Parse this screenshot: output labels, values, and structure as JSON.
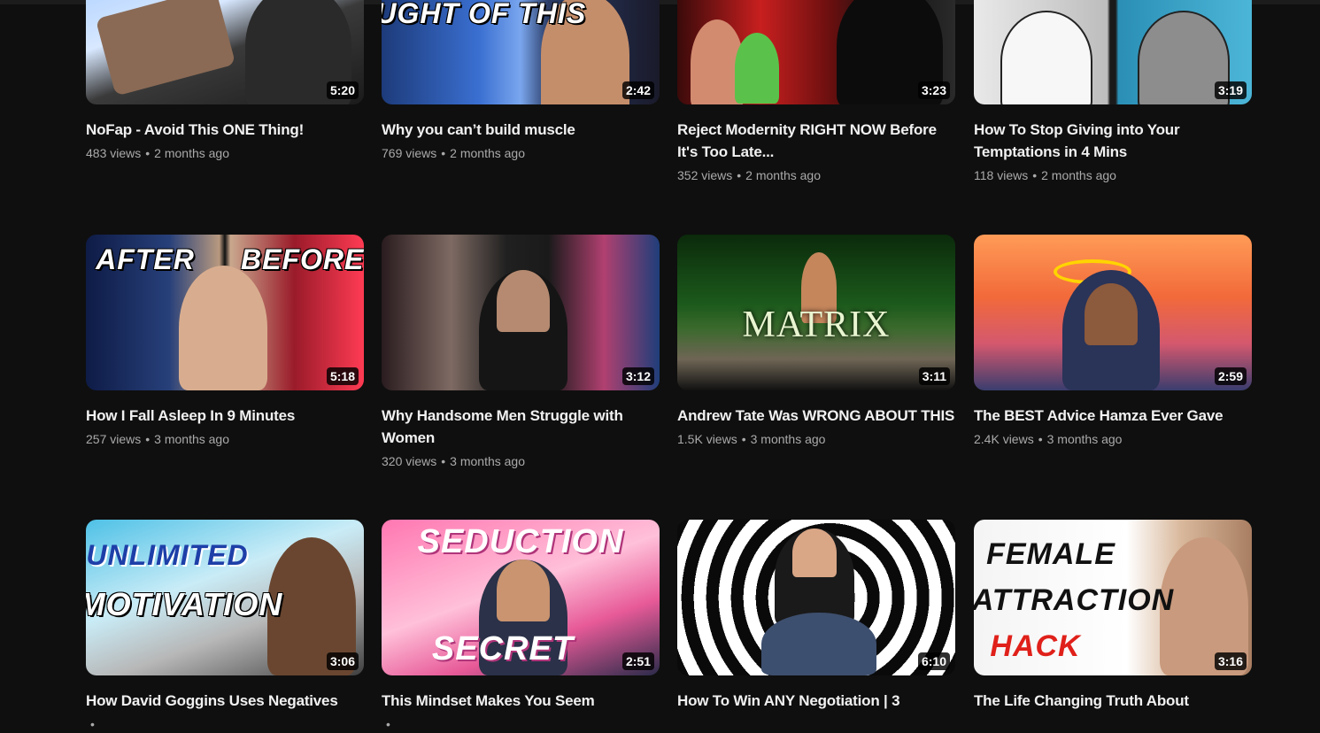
{
  "videos": [
    {
      "title": "NoFap - Avoid This ONE Thing!",
      "views": "483 views",
      "age": "2 months ago",
      "duration": "5:20",
      "overlay": ""
    },
    {
      "title": "Why you can’t build muscle",
      "views": "769 views",
      "age": "2 months ago",
      "duration": "2:42",
      "overlay": "THOUGHT OF THIS"
    },
    {
      "title": "Reject Modernity RIGHT NOW Before It's Too Late...",
      "views": "352 views",
      "age": "2 months ago",
      "duration": "3:23",
      "overlay": ""
    },
    {
      "title": "How To Stop Giving into Your Temptations in 4 Mins",
      "views": "118 views",
      "age": "2 months ago",
      "duration": "3:19",
      "overlay": ""
    },
    {
      "title": "How I Fall Asleep In 9 Minutes",
      "views": "257 views",
      "age": "3 months ago",
      "duration": "5:18",
      "overlay_left": "AFTER",
      "overlay_right": "BEFORE"
    },
    {
      "title": "Why Handsome Men Struggle with Women",
      "views": "320 views",
      "age": "3 months ago",
      "duration": "3:12",
      "overlay": ""
    },
    {
      "title": "Andrew Tate Was WRONG ABOUT THIS",
      "views": "1.5K views",
      "age": "3 months ago",
      "duration": "3:11",
      "overlay": "MATRIX"
    },
    {
      "title": "The BEST Advice Hamza Ever Gave",
      "views": "2.4K views",
      "age": "3 months ago",
      "duration": "2:59",
      "overlay": ""
    },
    {
      "title": "How David Goggins Uses Negatives",
      "views": "",
      "age": "",
      "duration": "3:06",
      "overlay_left": "UNLIMITED",
      "overlay_right": "MOTIVATION"
    },
    {
      "title": "This Mindset Makes You Seem",
      "views": "",
      "age": "",
      "duration": "2:51",
      "overlay_left": "SEDUCTION",
      "overlay_right": "SECRET"
    },
    {
      "title": "How To Win ANY Negotiation | 3",
      "views": "",
      "age": "",
      "duration": "6:10",
      "overlay": ""
    },
    {
      "title": "The Life Changing Truth About",
      "views": "",
      "age": "",
      "duration": "3:16",
      "overlay_left": "FEMALE",
      "overlay_mid": "ATTRACTION",
      "overlay_right": "HACK"
    }
  ],
  "separator": "•"
}
